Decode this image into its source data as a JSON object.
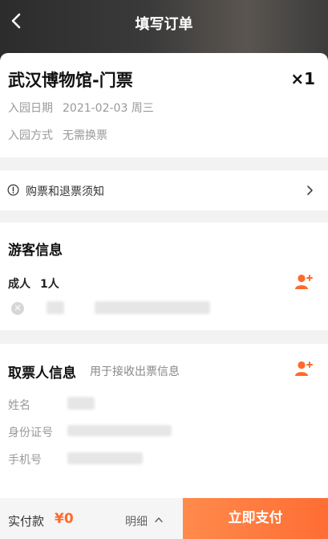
{
  "header": {
    "title": "填写订单",
    "back_icon": "chevron-left-icon"
  },
  "ticket": {
    "name": "武汉博物馆-门票",
    "quantity": "×1",
    "date_label": "入园日期",
    "date_value": "2021-02-03 周三",
    "entry_label": "入园方式",
    "entry_value": "无需换票"
  },
  "notice": {
    "label": "购票和退票须知",
    "icon": "info-circle-icon"
  },
  "guests": {
    "title": "游客信息",
    "adult_label": "成人",
    "adult_count": "1人",
    "add_icon": "add-person-icon",
    "remove_icon": "remove-circle-icon"
  },
  "picker": {
    "title": "取票人信息",
    "subtitle": "用于接收出票信息",
    "name_label": "姓名",
    "id_label": "身份证号",
    "phone_label": "手机号"
  },
  "footer": {
    "pay_label": "实付款",
    "amount": "¥0",
    "details_label": "明细",
    "pay_button": "立即支付"
  },
  "colors": {
    "accent": "#ff6a2c",
    "header_bg": "#2c2c2c"
  }
}
